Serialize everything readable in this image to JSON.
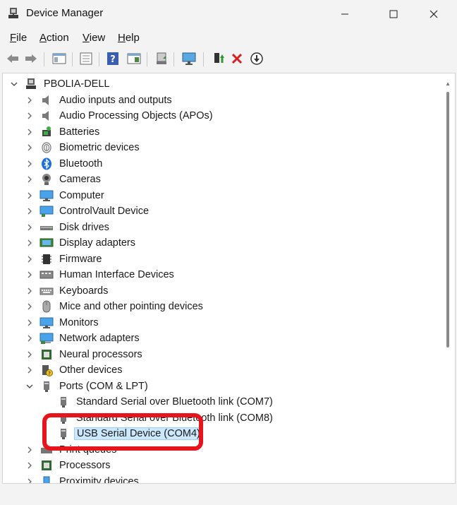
{
  "window": {
    "title": "Device Manager"
  },
  "menu": [
    {
      "name": "menu-file",
      "accel": "F",
      "rest": "ile"
    },
    {
      "name": "menu-action",
      "accel": "A",
      "rest": "ction"
    },
    {
      "name": "menu-view",
      "accel": "V",
      "rest": "iew"
    },
    {
      "name": "menu-help",
      "accel": "H",
      "rest": "elp"
    }
  ],
  "tree": {
    "root": "PBOLIA-DELL",
    "categories": [
      "Audio inputs and outputs",
      "Audio Processing Objects (APOs)",
      "Batteries",
      "Biometric devices",
      "Bluetooth",
      "Cameras",
      "Computer",
      "ControlVault Device",
      "Disk drives",
      "Display adapters",
      "Firmware",
      "Human Interface Devices",
      "Keyboards",
      "Mice and other pointing devices",
      "Monitors",
      "Network adapters",
      "Neural processors",
      "Other devices",
      "Ports (COM & LPT)"
    ],
    "ports_children": [
      "Standard Serial over Bluetooth link (COM7)",
      "Standard Serial over Bluetooth link (COM8)",
      "USB Serial Device (COM4)"
    ],
    "after_ports": [
      "Print queues",
      "Processors",
      "Proximity devices"
    ]
  },
  "colors": {
    "highlight": "#e8141b",
    "selection": "#cce8ff",
    "accent": "#0067c0"
  }
}
